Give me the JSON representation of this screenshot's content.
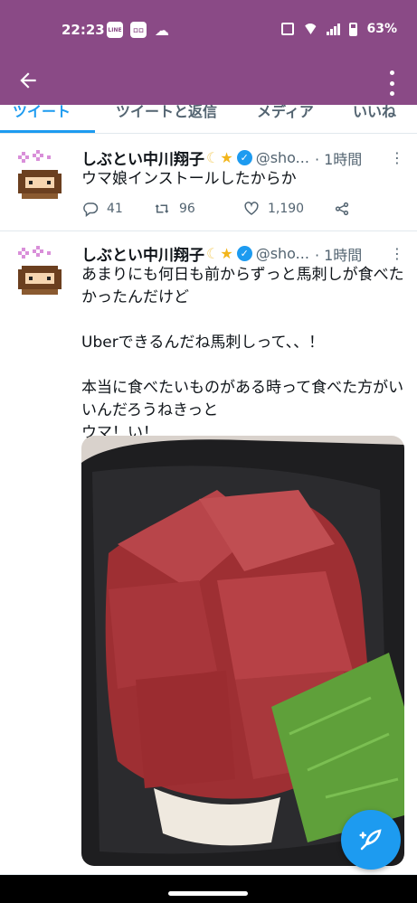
{
  "status_bar": {
    "time": "22:23",
    "notification_icons": [
      "line-icon",
      "app-icon",
      "cloud-icon"
    ],
    "notification_labels": [
      "LINE",
      "ロロ"
    ],
    "battery": "63%",
    "background_color": "#8a4a86"
  },
  "app_bar": {
    "back_icon": "arrow-left-icon",
    "menu_icon": "more-vertical-icon"
  },
  "tabs": [
    {
      "label": "ツイート",
      "active": true
    },
    {
      "label": "ツイートと返信",
      "active": false
    },
    {
      "label": "メディア",
      "active": false
    },
    {
      "label": "いいね",
      "active": false
    }
  ],
  "tweets": [
    {
      "name": "しぶとい中川翔子",
      "emoji": "🌙⭐",
      "handle": "@sho...",
      "time": "· 1時間",
      "text": "ウマ娘インストールしたからか",
      "replies": "41",
      "retweets": "96",
      "likes": "1,190"
    },
    {
      "name": "しぶとい中川翔子",
      "emoji": "🌙⭐",
      "handle": "@sho...",
      "time": "· 1時間",
      "text": "あまりにも何日も前からずっと馬刺しが食べたかったんだけど\n\nUberできるんだね馬刺しって、、！\n\n本当に食べたいものがある時って食べた方がいいんだろうねきっと\nウマ！い！",
      "has_image": true,
      "image_subject": "horse-sashimi-in-container"
    }
  ],
  "fab": {
    "icon": "compose-feather-icon",
    "color": "#1d9bf0"
  }
}
